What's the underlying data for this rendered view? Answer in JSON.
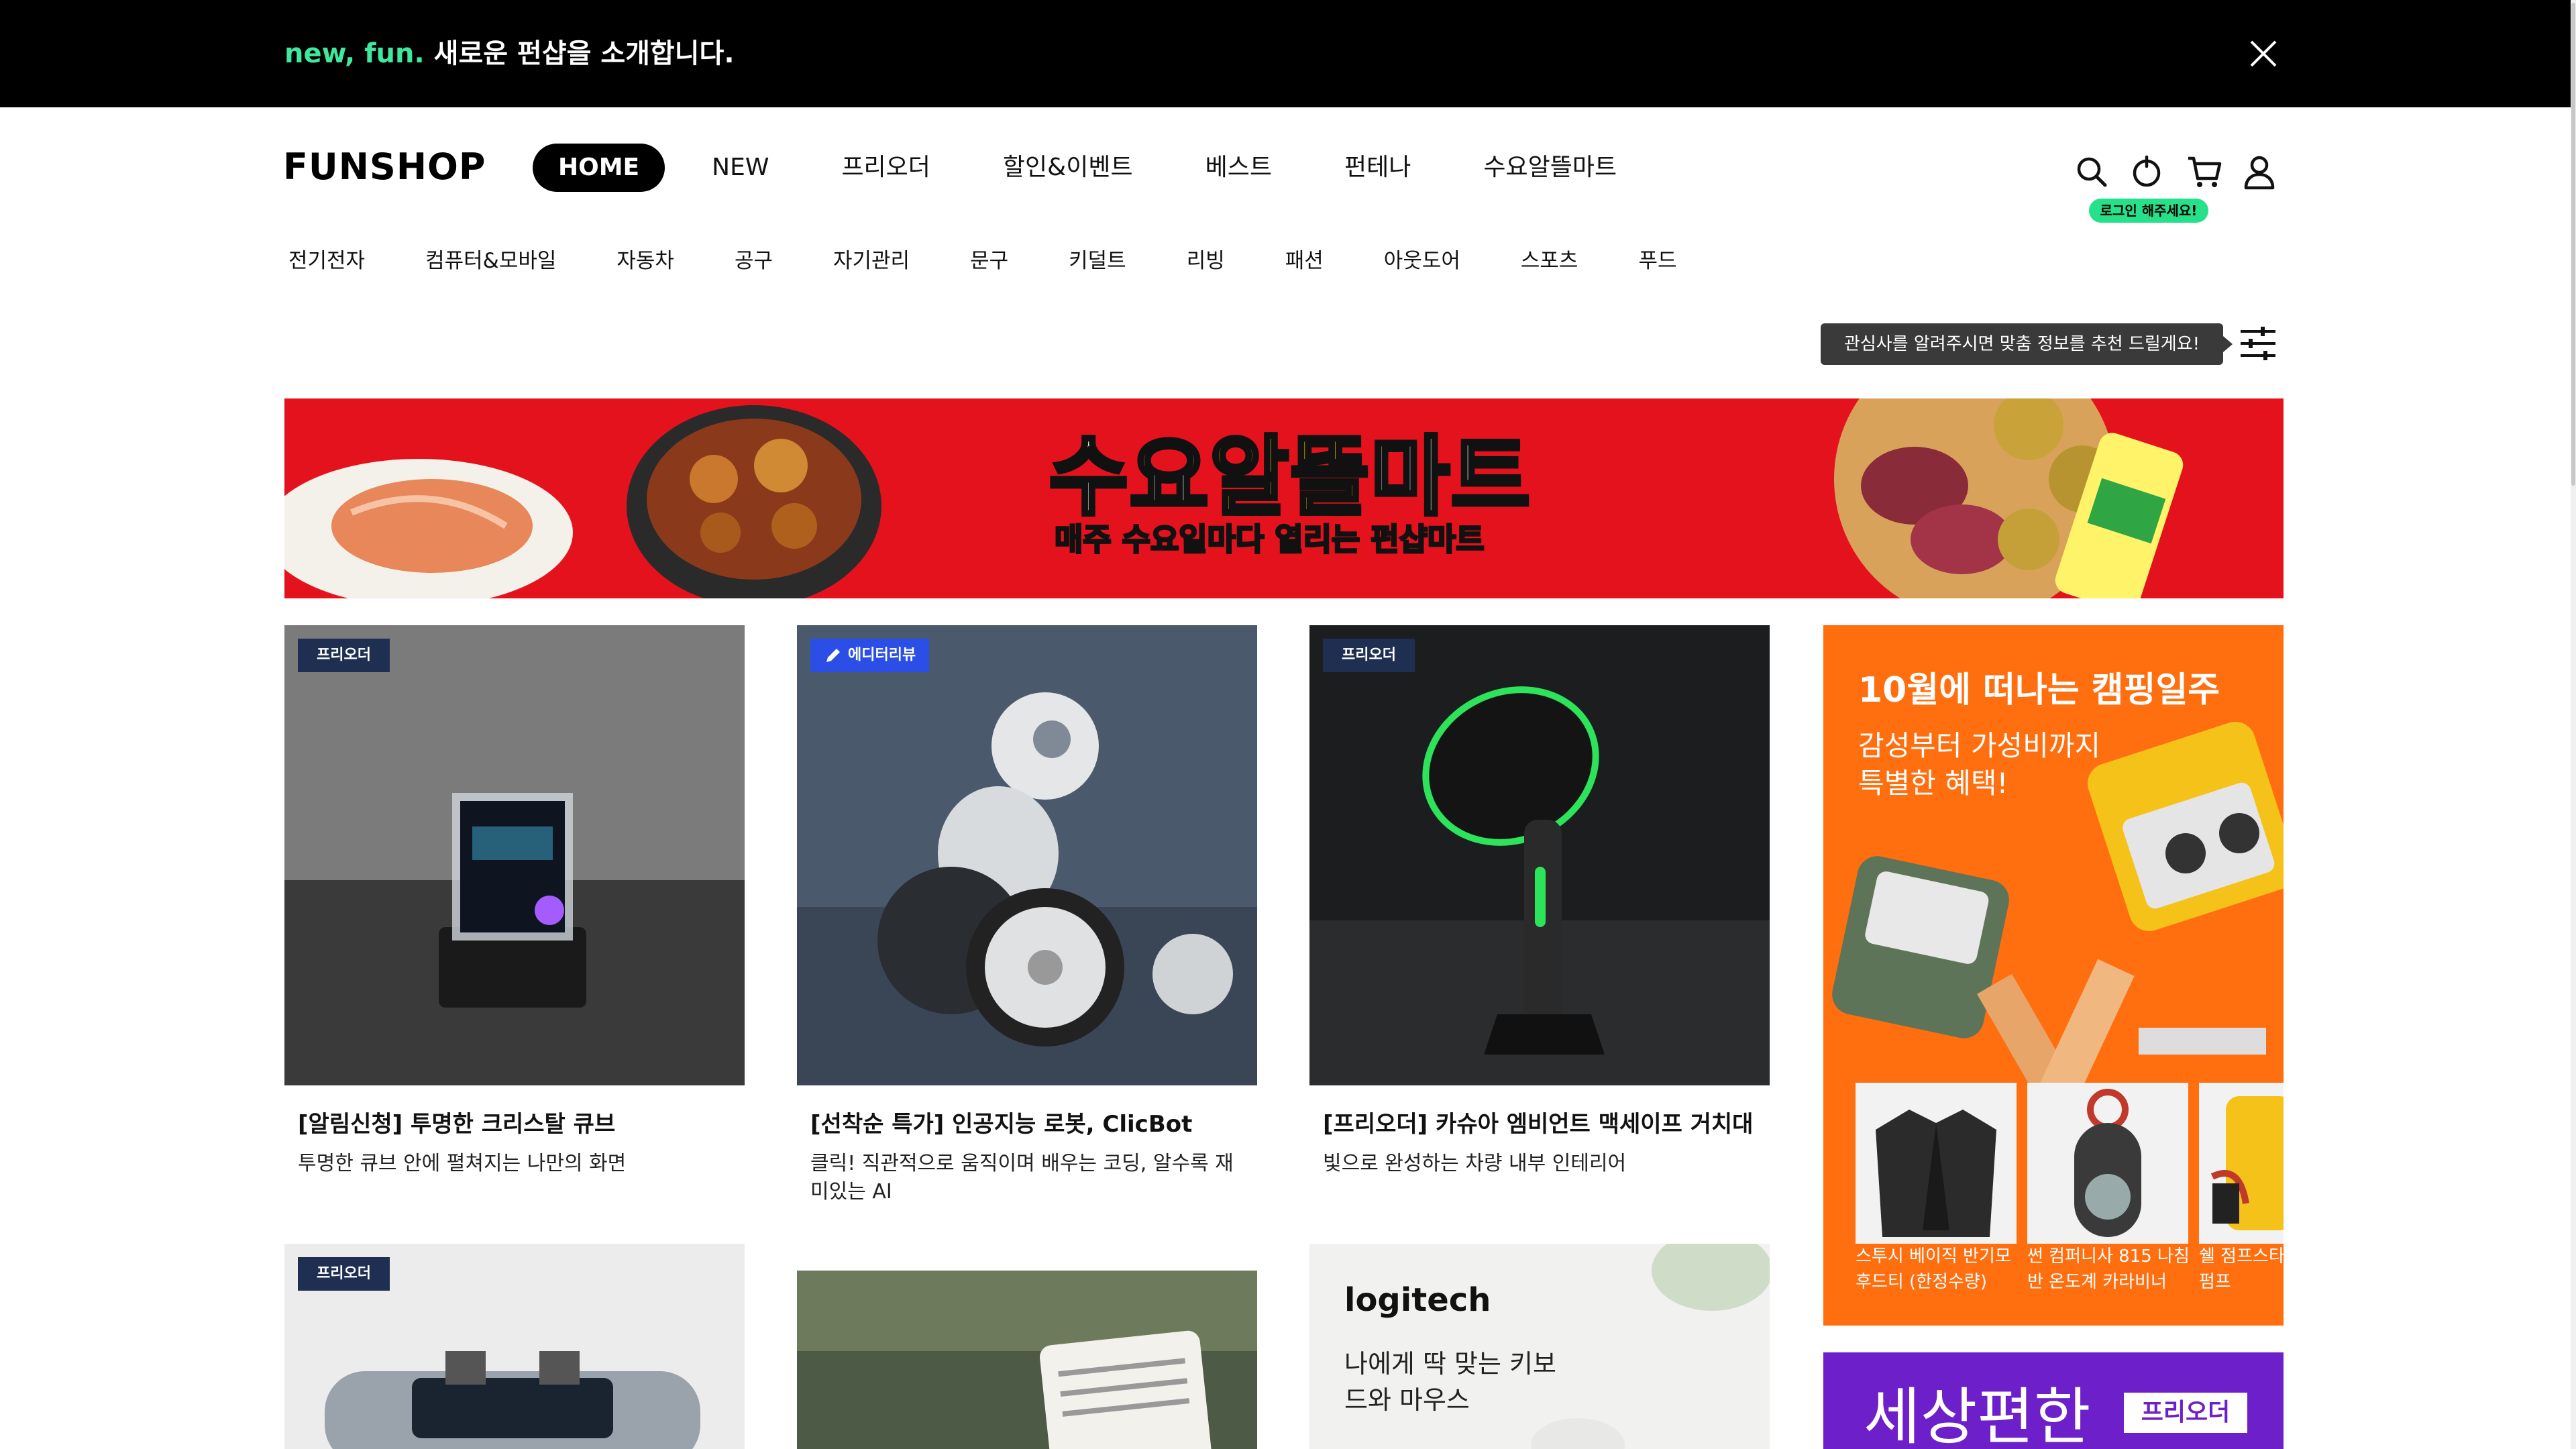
{
  "announcement": {
    "accent": "new, fun.",
    "text": "새로운 펀샵을 소개합니다.",
    "close_icon": "close-icon",
    "accent_color": "#3ee89c"
  },
  "header": {
    "logo": "FUNSHOP",
    "nav": [
      "HOME",
      "NEW",
      "프리오더",
      "할인&이벤트",
      "베스트",
      "펀테나",
      "수요알뜰마트"
    ],
    "active_nav": "HOME",
    "icons": [
      "search-icon",
      "clock-icon",
      "cart-icon",
      "user-icon"
    ],
    "login_hint": "로그인 해주세요!",
    "login_hint_color": "#27e08a"
  },
  "categories": [
    "전기전자",
    "컴퓨터&모바일",
    "자동차",
    "공구",
    "자기관리",
    "문구",
    "키덜트",
    "리빙",
    "패션",
    "아웃도어",
    "스포츠",
    "푸드"
  ],
  "recommend_tooltip": "관심사를 알려주시면 맞춤 정보를 추천 드릴게요!",
  "banner": {
    "title_part1": "수요",
    "title_part2": "알뜰",
    "title_part3": "마트",
    "subtitle": "매주 수요일마다 열리는 펀샵마트",
    "background": "#e4121c"
  },
  "products": [
    {
      "badge": "프리오더",
      "title": "[알림신청] 투명한 크리스탈 큐브",
      "desc": "투명한 큐브 안에 펼쳐지는 나만의 화면"
    },
    {
      "badge": "에디터리뷰",
      "title": "[선착순 특가] 인공지능 로봇, ClicBot",
      "desc": "클릭! 직관적으로 움직이며 배우는 코딩, 알수록 재미있는 AI"
    },
    {
      "badge": "프리오더",
      "title": "[프리오더] 카슈아 엠비언트 맥세이프 거치대",
      "desc": "빛으로 완성하는 차량 내부 인테리어"
    },
    {
      "badge": "프리오더",
      "title": "",
      "desc": ""
    },
    {
      "badge": "",
      "title": "",
      "desc": ""
    },
    {
      "badge": "",
      "title": "",
      "desc": "",
      "brand": "logitech",
      "headline": "나에게 딱 맞는 키보드와 마우스"
    }
  ],
  "promo": {
    "title": "10월에 떠나는 캠핑일주",
    "subtitle_line1": "감성부터 가성비까지",
    "subtitle_line2": "특별한 혜택!",
    "background": "#ff6f0f",
    "items": [
      {
        "name1": "스투시 베이직 반기모",
        "name2": "후드티 (한정수량)"
      },
      {
        "name1": "썬 컴퍼니사 815 나침",
        "name2": "반 온도계 카라비너"
      },
      {
        "name1": "쉘 점프스타",
        "name2": "펌프"
      }
    ]
  },
  "promo2": {
    "title": "세상편한",
    "badge": "프리오더",
    "background": "#6d1fc9"
  }
}
